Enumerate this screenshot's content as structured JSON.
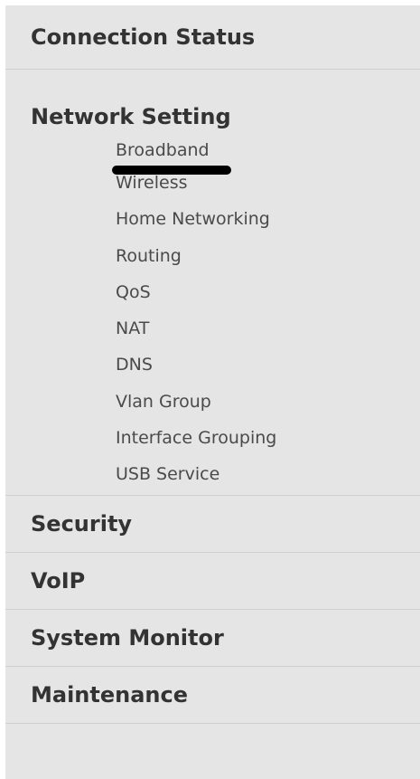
{
  "menu": {
    "sections": [
      {
        "label": "Connection Status"
      },
      {
        "label": "Network Setting",
        "items": [
          {
            "label": "Broadband"
          },
          {
            "label": "Wireless"
          },
          {
            "label": "Home Networking"
          },
          {
            "label": "Routing"
          },
          {
            "label": "QoS"
          },
          {
            "label": "NAT"
          },
          {
            "label": "DNS"
          },
          {
            "label": "Vlan Group"
          },
          {
            "label": "Interface Grouping"
          },
          {
            "label": "USB Service"
          }
        ]
      },
      {
        "label": "Security"
      },
      {
        "label": "VoIP"
      },
      {
        "label": "System Monitor"
      },
      {
        "label": "Maintenance"
      }
    ]
  },
  "colors": {
    "panel_background": "#e5e5e5",
    "header_text": "#333333",
    "item_text": "#4a4a4a",
    "divider": "#cfcfcf",
    "annotation_mark": "#000000"
  }
}
